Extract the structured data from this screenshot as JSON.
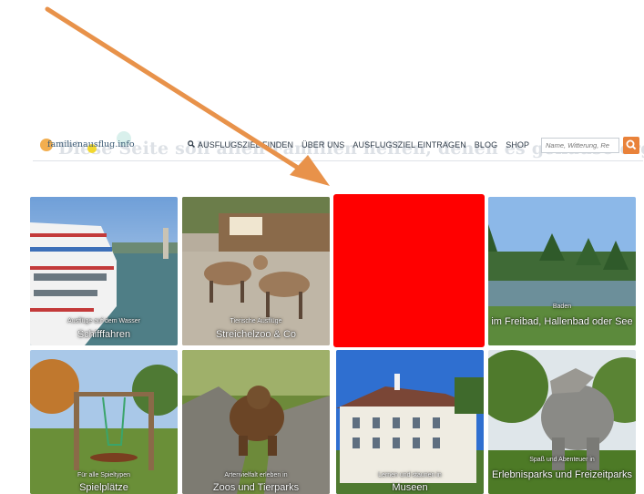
{
  "navbar": {
    "logo_text": "familienausflug.info",
    "menu": [
      {
        "label": "AUSFLUGSZIEL FINDEN",
        "icon": "search-icon"
      },
      {
        "label": "ÜBER UNS"
      },
      {
        "label": "AUSFLUGSZIEL EINTRAGEN"
      },
      {
        "label": "BLOG"
      },
      {
        "label": "SHOP"
      }
    ],
    "search_placeholder": "Name, Witterung, Re",
    "search_button_icon": "search-icon",
    "accent_color": "#e9823a"
  },
  "background_heading": "Diese Seite soll allen Familien helfen, denen es genauso ergeht",
  "tiles": [
    {
      "subtitle": "Ausflüge auf dem Wasser",
      "title": "Schifffahren"
    },
    {
      "subtitle": "Tierische Ausflüge",
      "title": "Streichelzoo & Co"
    },
    {
      "subtitle": "",
      "title": "",
      "highlight_color": "#ff0000"
    },
    {
      "subtitle": "Baden",
      "title": "im Freibad, Hallenbad oder See"
    },
    {
      "subtitle": "Für alle Spieltypen",
      "title": "Spielplätze"
    },
    {
      "subtitle": "Artenvielfalt erleben in",
      "title": "Zoos und Tierparks"
    },
    {
      "subtitle": "Lernen und staunen in",
      "title": "Museen"
    },
    {
      "subtitle": "Spaß und Abenteuer in",
      "title": "Erlebnisparks und Freizeitparks"
    }
  ],
  "annotation": {
    "arrow_color": "#e8924a"
  }
}
